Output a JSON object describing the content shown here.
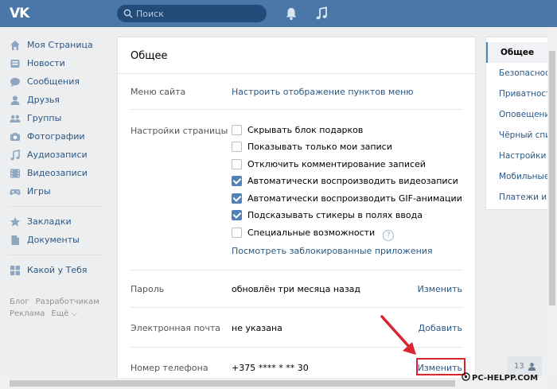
{
  "header": {
    "logo": "VK",
    "search_placeholder": "Поиск",
    "bell_icon": "bell-icon",
    "music_icon": "music-note-icon",
    "bg_color": "#4a76a8"
  },
  "left_menu": {
    "items": [
      {
        "label": "Моя Страница",
        "icon": "home-icon"
      },
      {
        "label": "Новости",
        "icon": "news-icon"
      },
      {
        "label": "Сообщения",
        "icon": "messages-icon"
      },
      {
        "label": "Друзья",
        "icon": "friends-icon"
      },
      {
        "label": "Группы",
        "icon": "groups-icon"
      },
      {
        "label": "Фотографии",
        "icon": "photo-icon"
      },
      {
        "label": "Аудиозаписи",
        "icon": "audio-icon"
      },
      {
        "label": "Видеозаписи",
        "icon": "video-icon"
      },
      {
        "label": "Игры",
        "icon": "gamepad-icon"
      },
      {
        "label": "Закладки",
        "icon": "star-icon"
      },
      {
        "label": "Документы",
        "icon": "document-icon"
      },
      {
        "label": "Какой у Тебя",
        "icon": "app-grid-icon"
      }
    ],
    "footer_links": [
      "Блог",
      "Разработчикам",
      "Реклама",
      "Ещё ⌵"
    ]
  },
  "settings": {
    "title": "Общее",
    "site_menu": {
      "label": "Меню сайта",
      "link": "Настроить отображение пунктов меню"
    },
    "page_settings": {
      "label": "Настройки страницы",
      "options": [
        {
          "text": "Скрывать блок подарков",
          "checked": false
        },
        {
          "text": "Показывать только мои записи",
          "checked": false
        },
        {
          "text": "Отключить комментирование записей",
          "checked": false
        },
        {
          "text": "Автоматически воспроизводить видеозаписи",
          "checked": true
        },
        {
          "text": "Автоматически воспроизводить GIF-анимации",
          "checked": true
        },
        {
          "text": "Подсказывать стикеры в полях ввода",
          "checked": true
        },
        {
          "text": "Специальные возможности",
          "checked": false
        }
      ],
      "help_symbol": "?",
      "blocked_apps_link": "Посмотреть заблокированные приложения"
    },
    "password": {
      "label": "Пароль",
      "value": "обновлён три месяца назад",
      "action": "Изменить"
    },
    "email": {
      "label": "Электронная почта",
      "value": "не указана",
      "action": "Добавить"
    },
    "phone": {
      "label": "Номер телефона",
      "value": "+375 **** * ** 30",
      "action": "Изменить"
    }
  },
  "right_menu": {
    "items": [
      {
        "label": "Общее",
        "active": true
      },
      {
        "label": "Безопасность",
        "active": false
      },
      {
        "label": "Приватность",
        "active": false
      },
      {
        "label": "Оповещения",
        "active": false
      },
      {
        "label": "Чёрный список",
        "active": false
      },
      {
        "label": "Настройки приложений",
        "active": false
      },
      {
        "label": "Мобильные сервисы",
        "active": false
      },
      {
        "label": "Платежи и переводы",
        "active": false
      }
    ]
  },
  "corner_widget": {
    "count": "13"
  },
  "watermark": "PC-HELPP.COM",
  "highlight_color": "#d9262e"
}
